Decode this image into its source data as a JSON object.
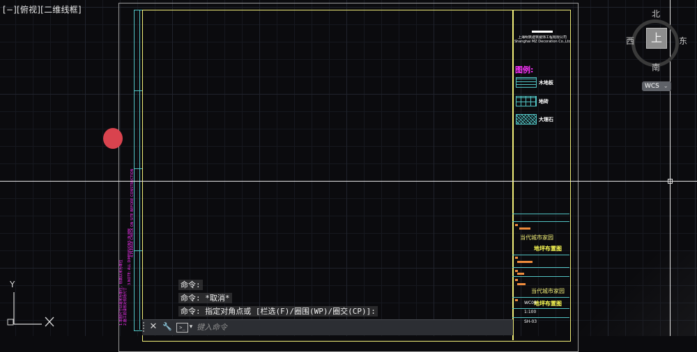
{
  "viewport": {
    "label": "[−][俯视][二维线框]"
  },
  "viewcube": {
    "top_face": "上",
    "north": "北",
    "south": "南",
    "east": "东",
    "west": "西",
    "wcs_label": "WCS",
    "wcs_caret": "⌄"
  },
  "ucs": {
    "x_label": "X",
    "y_label": "Y"
  },
  "drawing": {
    "company_lines": [
      "上海明筑建筑装饰工程有限公司",
      "Shanghai MZ Decoration Co.,Ltd"
    ],
    "legend_title": "图例:",
    "legend_items": [
      {
        "label": "木地板",
        "icon": "wood-floor-hatch"
      },
      {
        "label": "地砖",
        "icon": "floor-tile-grid"
      },
      {
        "label": "大理石",
        "icon": "marble-hatch"
      }
    ],
    "title_block": {
      "project_1": "当代城市家园",
      "drawing_1": "地坪布置图",
      "project_2": "当代城市家园",
      "drawing_2": "地坪布置图",
      "scale": "1:100",
      "code": "WC08",
      "sheet": "SH-03"
    },
    "vertical_notes": [
      "1.本图尺寸以毫米为单位，标高以米为单位",
      "2.施工前请核对现场尺寸",
      "3.NOTE: ALL DIMENSIONS IN MM",
      "4.PLEASE CHECK ON SITE BEFORE CONSTRUCTION"
    ]
  },
  "command": {
    "history": [
      "命令:",
      "命令: *取消*",
      "命令: 指定对角点或 [栏选(F)/圈围(WP)/圈交(CP)]:"
    ],
    "close_icon": "✕",
    "customize_icon": "🔧",
    "prompt_icon": ">_",
    "dropdown_icon": "▾",
    "placeholder": "键入命令"
  },
  "colors": {
    "frame_yellow": "#f3f07a",
    "cyan": "#52c4c4",
    "magenta": "#ff33ff",
    "marker_red": "#d9434e",
    "orange": "#f08c3c"
  }
}
